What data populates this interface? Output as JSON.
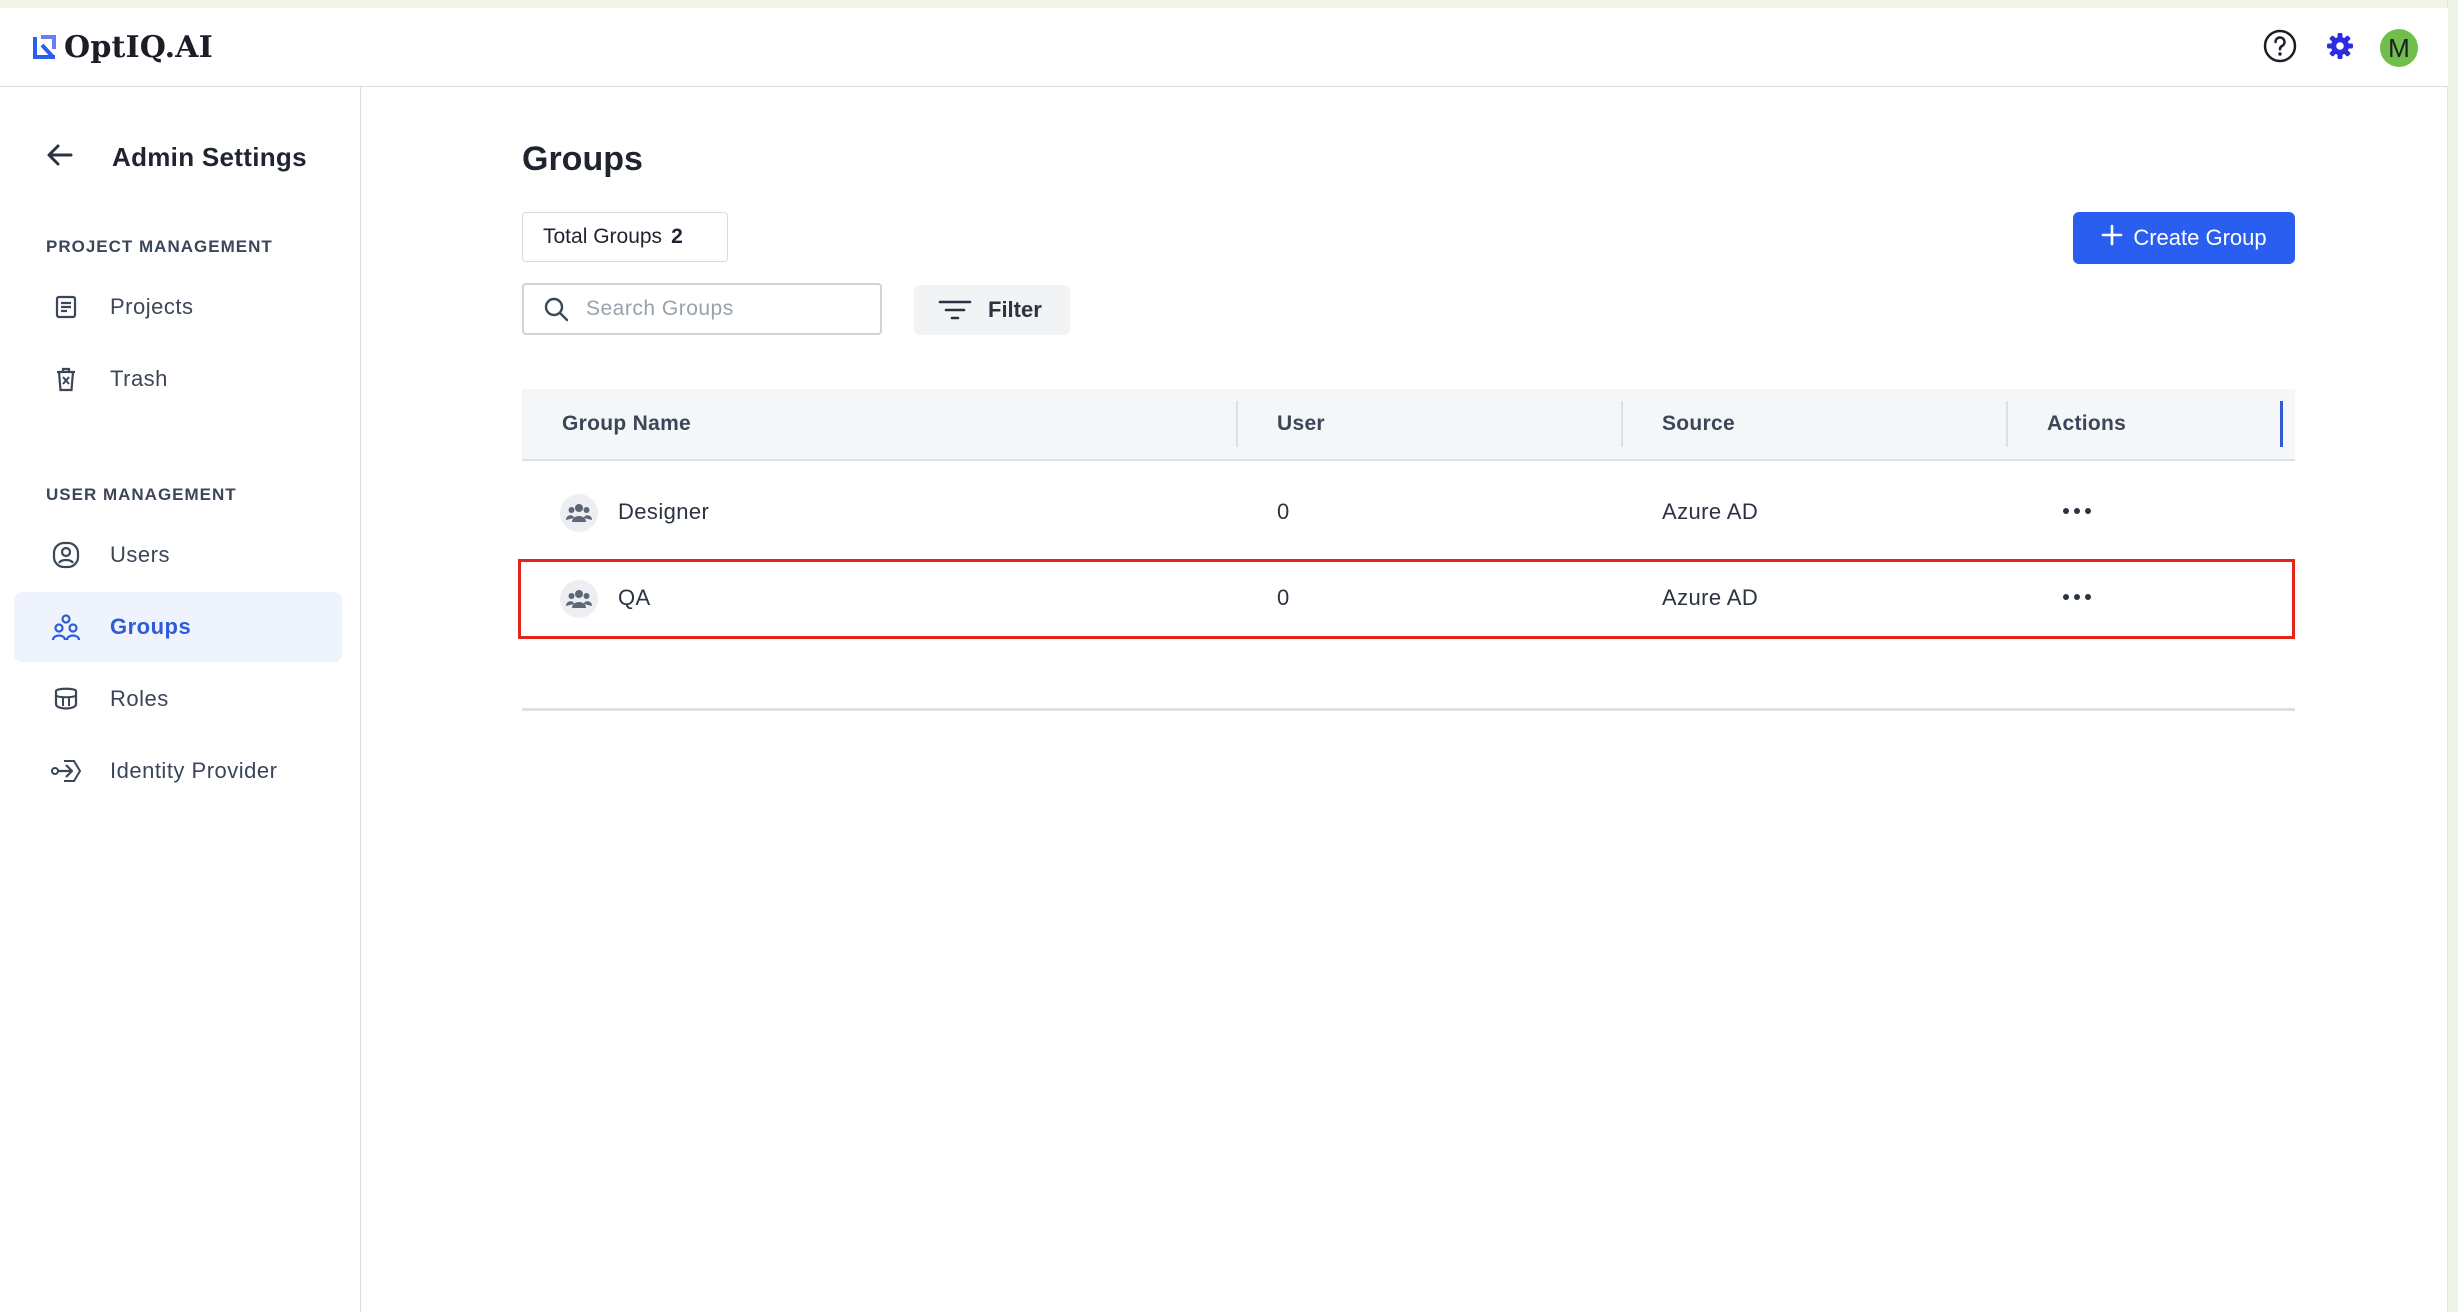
{
  "app": {
    "logo_text": "OptIQ.AI",
    "avatar_initial": "M"
  },
  "colors": {
    "accent": "#2a5ef0",
    "active_nav": "#2f5bd7",
    "highlight": "#e2261b",
    "avatar": "#6fbf4a"
  },
  "sidebar": {
    "title": "Admin Settings",
    "project_section": "PROJECT MANAGEMENT",
    "project_items": [
      {
        "label": "Projects",
        "icon": "document-icon"
      },
      {
        "label": "Trash",
        "icon": "trash-icon"
      }
    ],
    "user_section": "USER MANAGEMENT",
    "user_items": [
      {
        "label": "Users",
        "icon": "user-icon"
      },
      {
        "label": "Groups",
        "icon": "groups-icon",
        "active": true
      },
      {
        "label": "Roles",
        "icon": "shield-icon"
      },
      {
        "label": "Identity Provider",
        "icon": "identity-icon"
      }
    ]
  },
  "main": {
    "title": "Groups",
    "total_label": "Total Groups",
    "total_count": "2",
    "create_button": "Create Group",
    "search_placeholder": "Search Groups",
    "filter_label": "Filter",
    "table": {
      "columns": [
        "Group Name",
        "User",
        "Source",
        "Actions"
      ],
      "rows": [
        {
          "name": "Designer",
          "users": "0",
          "source": "Azure AD"
        },
        {
          "name": "QA",
          "users": "0",
          "source": "Azure AD"
        }
      ]
    }
  }
}
